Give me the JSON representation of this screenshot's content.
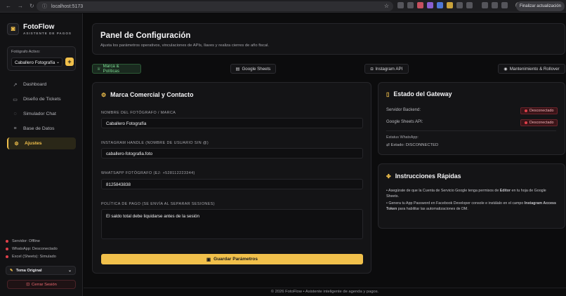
{
  "browser": {
    "url": "localhost:5173",
    "update_label": "Finalizar actualización"
  },
  "sidebar": {
    "brand_name": "FotoFlow",
    "brand_subtitle": "ASISTENTE DE PAGOS",
    "active_photographer_label": "Fotógrafo Activo:",
    "active_photographer_value": "Caballero Fotografía",
    "add_button": "+",
    "items": [
      {
        "label": "Dashboard",
        "icon": "chart-trend-icon"
      },
      {
        "label": "Diseño de Tickets",
        "icon": "ticket-icon"
      },
      {
        "label": "Simulador Chat",
        "icon": "chat-icon"
      },
      {
        "label": "Base de Datos",
        "icon": "database-icon"
      },
      {
        "label": "Ajustes",
        "icon": "gear-icon"
      }
    ],
    "status": {
      "server": "Servidor: Offline",
      "whatsapp": "WhatsApp: Desconectado",
      "excel": "Excel (Sheets): Simulado"
    },
    "theme_label": "Tema Original",
    "logout_label": "Cerrar Sesión"
  },
  "header": {
    "title": "Panel de Configuración",
    "subtitle": "Ajusta los parámetros operativos, vinculaciones de APIs, llaves y realiza cierres de año fiscal."
  },
  "tabs": [
    {
      "label": "Marca & Políticas",
      "active": true
    },
    {
      "label": "Google Sheets",
      "active": false
    },
    {
      "label": "Instagram API",
      "active": false
    },
    {
      "label": "Mantenimiento & Rollover",
      "active": false
    }
  ],
  "brand_form": {
    "title": "Marca Comercial y Contacto",
    "name_label": "NOMBRE DEL FOTÓGRAFO / MARCA",
    "name_value": "Caballero Fotografía",
    "instagram_label": "INSTAGRAM HANDLE (NOMBRE DE USUARIO SIN @)",
    "instagram_value": "caballero-fotografia.foto",
    "whatsapp_label": "WHATSAPP FOTÓGRAFO (EJ: +528112223344)",
    "whatsapp_value": "8125843838",
    "policy_label": "POLÍTICA DE PAGO (SE ENVÍA AL SEPARAR SESIONES)",
    "policy_value": "El saldo total debe liquidarse antes de la sesión",
    "save_label": "Guardar Parámetros"
  },
  "gateway": {
    "title": "Estado del Gateway",
    "backend_label": "Servidor Backend:",
    "backend_status": "Desconectado",
    "sheets_label": "Google Sheets API:",
    "sheets_status": "Desconectado",
    "whatsapp_label": "Estatus WhatsApp:",
    "whatsapp_state": "Estado: DISCONNECTED"
  },
  "instructions": {
    "title": "Instrucciones Rápidas",
    "item1_pre": "• Asegúrate de que la Cuenta de Servicio Google tenga permisos de ",
    "item1_bold": "Editor",
    "item1_post": " en tu hoja de Google Sheets.",
    "item2_pre": "• Genera tu App Password en Facebook Developer console e instálalo en el campo ",
    "item2_bold": "Instagram Access Token",
    "item2_post": " para habilitar las automatizaciones de DM."
  },
  "footer": "© 2026 FotoFlow • Asistente inteligente de agenda y pagos.",
  "colors": {
    "accent": "#f1c04b",
    "danger": "#e0404a",
    "success": "#7ddc93"
  }
}
